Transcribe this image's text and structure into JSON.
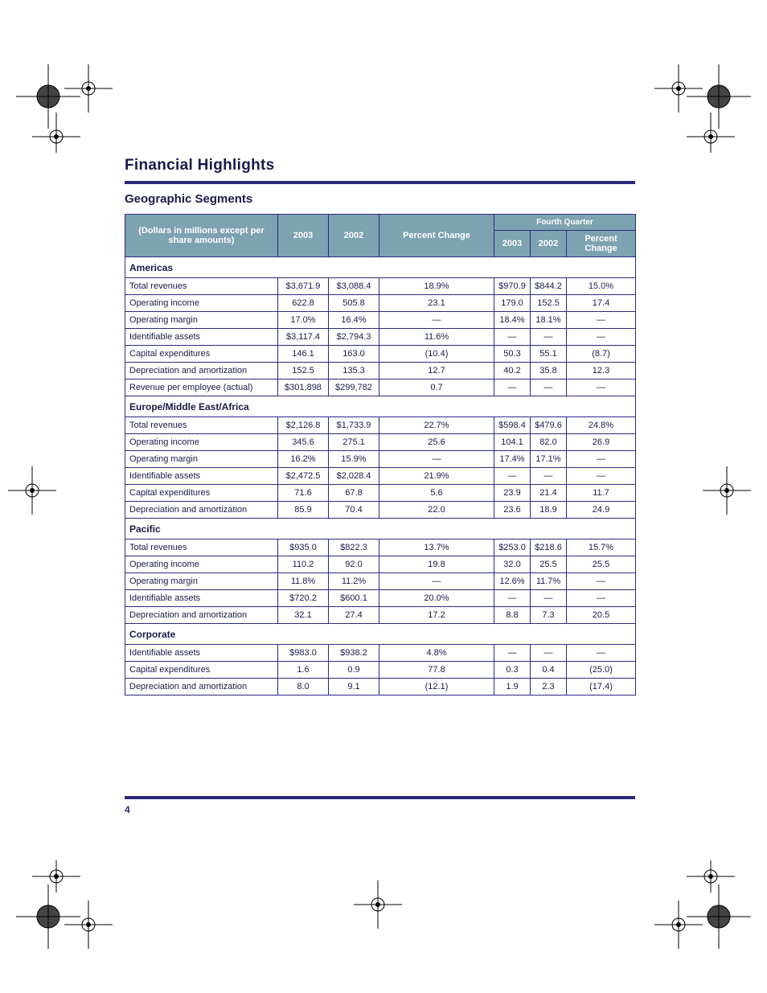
{
  "doc_title": "Financial Highlights",
  "subtitle": "Geographic Segments",
  "page_number": "4",
  "headers": {
    "desc": "(Dollars in millions except per share amounts)",
    "c1": "2003",
    "c2": "2002",
    "c3": "Percent Change",
    "group": "Fourth Quarter",
    "g1": "2003",
    "g2": "2002",
    "g3": "Percent Change"
  },
  "sections": [
    {
      "title": "Americas",
      "rows": [
        {
          "label": "Total revenues",
          "c1": "$3,671.9",
          "c2": "$3,088.4",
          "c3": "18.9%",
          "g1": "$970.9",
          "g2": "$844.2",
          "g3": "15.0%"
        },
        {
          "label": "Operating income",
          "c1": "622.8",
          "c2": "505.8",
          "c3": "23.1",
          "g1": "179.0",
          "g2": "152.5",
          "g3": "17.4"
        },
        {
          "label": "Operating margin",
          "c1": "17.0%",
          "c2": "16.4%",
          "c3": "—",
          "g1": "18.4%",
          "g2": "18.1%",
          "g3": "—"
        },
        {
          "label": "Identifiable assets",
          "c1": "$3,117.4",
          "c2": "$2,794.3",
          "c3": "11.6%",
          "g1": "—",
          "g2": "—",
          "g3": "—"
        },
        {
          "label": "Capital expenditures",
          "c1": "146.1",
          "c2": "163.0",
          "c3": "(10.4)",
          "g1": "50.3",
          "g2": "55.1",
          "g3": "(8.7)"
        },
        {
          "label": "Depreciation and amortization",
          "c1": "152.5",
          "c2": "135.3",
          "c3": "12.7",
          "g1": "40.2",
          "g2": "35.8",
          "g3": "12.3"
        },
        {
          "label": "Revenue per employee (actual)",
          "c1": "$301,898",
          "c2": "$299,782",
          "c3": "0.7",
          "g1": "—",
          "g2": "—",
          "g3": "—"
        }
      ]
    },
    {
      "title": "Europe/Middle East/Africa",
      "rows": [
        {
          "label": "Total revenues",
          "c1": "$2,126.8",
          "c2": "$1,733.9",
          "c3": "22.7%",
          "g1": "$598.4",
          "g2": "$479.6",
          "g3": "24.8%"
        },
        {
          "label": "Operating income",
          "c1": "345.6",
          "c2": "275.1",
          "c3": "25.6",
          "g1": "104.1",
          "g2": "82.0",
          "g3": "26.9"
        },
        {
          "label": "Operating margin",
          "c1": "16.2%",
          "c2": "15.9%",
          "c3": "—",
          "g1": "17.4%",
          "g2": "17.1%",
          "g3": "—"
        },
        {
          "label": "Identifiable assets",
          "c1": "$2,472.5",
          "c2": "$2,028.4",
          "c3": "21.9%",
          "g1": "—",
          "g2": "—",
          "g3": "—"
        },
        {
          "label": "Capital expenditures",
          "c1": "71.6",
          "c2": "67.8",
          "c3": "5.6",
          "g1": "23.9",
          "g2": "21.4",
          "g3": "11.7"
        },
        {
          "label": "Depreciation and amortization",
          "c1": "85.9",
          "c2": "70.4",
          "c3": "22.0",
          "g1": "23.6",
          "g2": "18.9",
          "g3": "24.9"
        }
      ]
    },
    {
      "title": "Pacific",
      "rows": [
        {
          "label": "Total revenues",
          "c1": "$935.0",
          "c2": "$822.3",
          "c3": "13.7%",
          "g1": "$253.0",
          "g2": "$218.6",
          "g3": "15.7%"
        },
        {
          "label": "Operating income",
          "c1": "110.2",
          "c2": "92.0",
          "c3": "19.8",
          "g1": "32.0",
          "g2": "25.5",
          "g3": "25.5"
        },
        {
          "label": "Operating margin",
          "c1": "11.8%",
          "c2": "11.2%",
          "c3": "—",
          "g1": "12.6%",
          "g2": "11.7%",
          "g3": "—"
        },
        {
          "label": "Identifiable assets",
          "c1": "$720.2",
          "c2": "$600.1",
          "c3": "20.0%",
          "g1": "—",
          "g2": "—",
          "g3": "—"
        },
        {
          "label": "Depreciation and amortization",
          "c1": "32.1",
          "c2": "27.4",
          "c3": "17.2",
          "g1": "8.8",
          "g2": "7.3",
          "g3": "20.5"
        }
      ]
    },
    {
      "title": "Corporate",
      "rows": [
        {
          "label": "Identifiable assets",
          "c1": "$983.0",
          "c2": "$938.2",
          "c3": "4.8%",
          "g1": "—",
          "g2": "—",
          "g3": "—"
        },
        {
          "label": "Capital expenditures",
          "c1": "1.6",
          "c2": "0.9",
          "c3": "77.8",
          "g1": "0.3",
          "g2": "0.4",
          "g3": "(25.0)"
        },
        {
          "label": "Depreciation and amortization",
          "c1": "8.0",
          "c2": "9.1",
          "c3": "(12.1)",
          "g1": "1.9",
          "g2": "2.3",
          "g3": "(17.4)"
        }
      ]
    }
  ]
}
